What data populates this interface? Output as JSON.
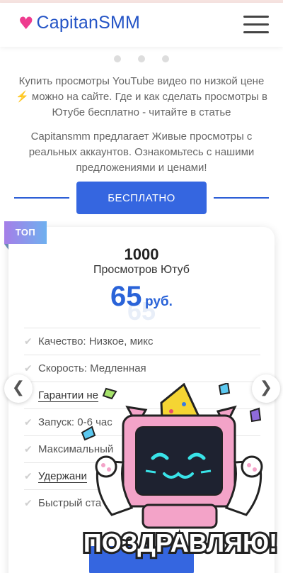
{
  "header": {
    "logo_text": "CapitanSMM",
    "logo_heart": "♥",
    "menu_icon": "hamburger-icon"
  },
  "carousel": {
    "dots": 3
  },
  "intro": {
    "line1": "Купить просмотры YouTube видео по низкой цене",
    "bolt": "⚡",
    "line2": " можно на сайте. Где и как сделать просмотры в Ютубе бесплатно - читайте в статье",
    "text2": "Capitansmm предлагает Живые просмотры с реальных аккаунтов. Ознакомьтесь с нашими предложениями и ценами!"
  },
  "cta": {
    "label": "БЕСПЛАТНО"
  },
  "card": {
    "badge": "ТОП",
    "quantity": "1000",
    "quantity_label": "Просмотров Ютуб",
    "price": "65",
    "currency": "руб.",
    "price_shadow": "65",
    "features": [
      "Качество: Низкое, микс",
      "Скорость: Медленная",
      "Гарантии не",
      "Запуск: 0-6 час",
      "Максимальный",
      "Удержани",
      "Быстрый ста"
    ]
  },
  "nav": {
    "prev": "❮",
    "next": "❯"
  },
  "sticker": {
    "caption": "ПОЗДРАВЛЯЮ!"
  },
  "colors": {
    "brand_blue": "#3566e0",
    "heart_pink": "#ee3c8f",
    "logo_blue": "#2454c6"
  }
}
